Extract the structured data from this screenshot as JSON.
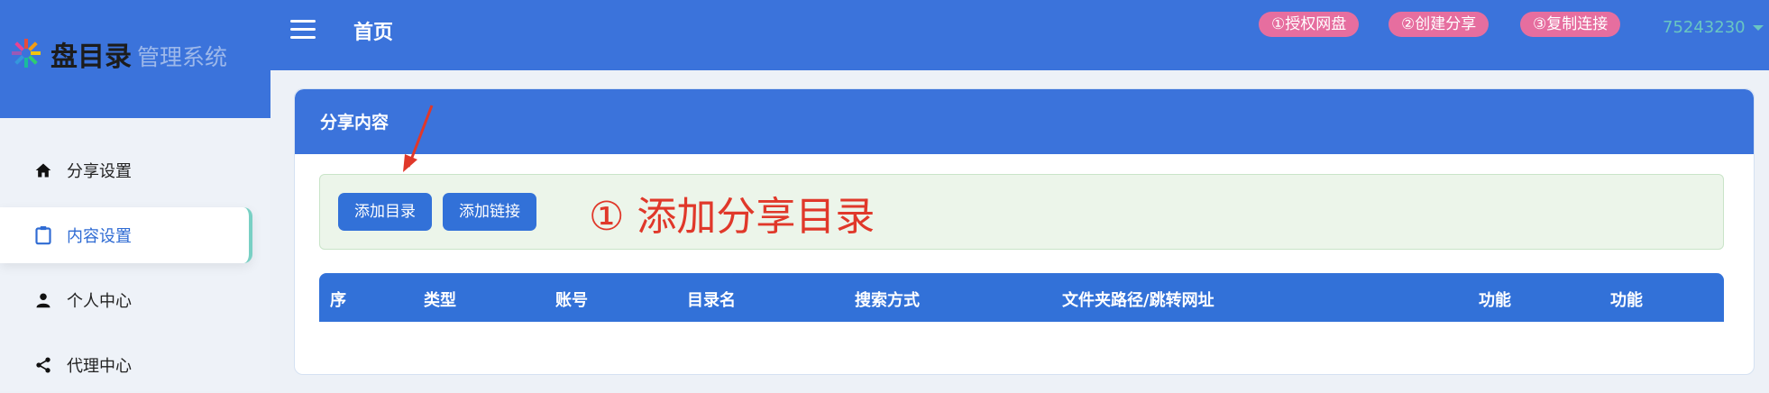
{
  "brand": {
    "main": "盘目录",
    "sub": "管理系统"
  },
  "sidebar": {
    "items": [
      {
        "label": "分享设置",
        "icon": "home-icon"
      },
      {
        "label": "内容设置",
        "icon": "clipboard-icon"
      },
      {
        "label": "个人中心",
        "icon": "person-icon"
      },
      {
        "label": "代理中心",
        "icon": "share-icon"
      }
    ],
    "active_index": 1
  },
  "header": {
    "title": "首页",
    "steps": [
      "①授权网盘",
      "②创建分享",
      "③复制连接"
    ],
    "user": "75243230"
  },
  "card": {
    "title": "分享内容",
    "buttons": [
      "添加目录",
      "添加链接"
    ],
    "annotation": "① 添加分享目录",
    "table_columns": [
      "序",
      "类型",
      "账号",
      "目录名",
      "搜索方式",
      "文件夹路径/跳转网址",
      "功能",
      "功能"
    ]
  },
  "colors": {
    "primary": "#3b73db",
    "pill": "#e66e9f",
    "annotation": "#e0382a",
    "user": "#69c6c2"
  }
}
